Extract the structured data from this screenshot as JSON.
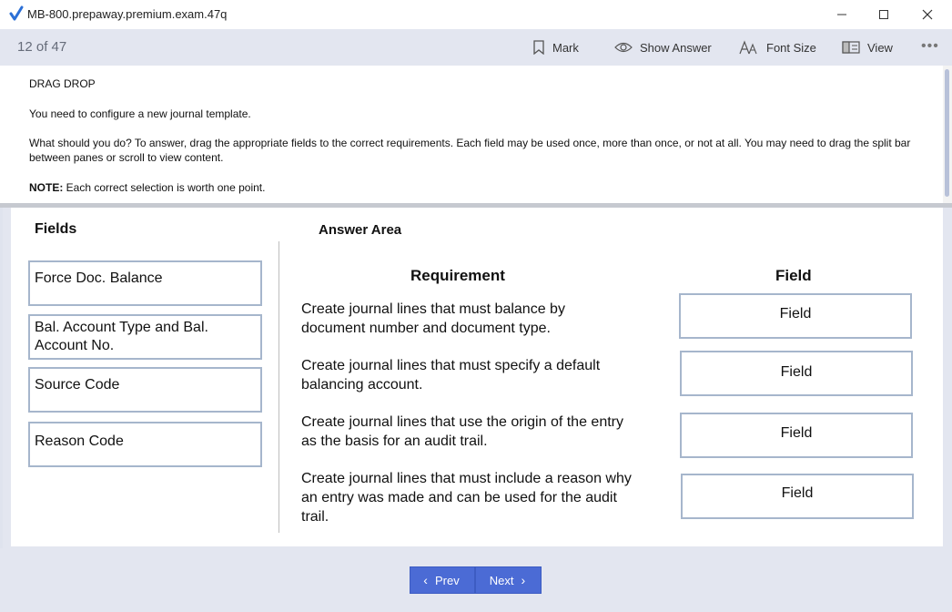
{
  "window": {
    "title": "MB-800.prepaway.premium.exam.47q"
  },
  "toolbar": {
    "counter": "12 of 47",
    "mark_label": "Mark",
    "show_answer_label": "Show Answer",
    "font_size_label": "Font Size",
    "view_label": "View",
    "more_label": "•••"
  },
  "question": {
    "type": "DRAG DROP",
    "intro": "You need to configure a new journal template.",
    "instructions": "What should you do? To answer, drag the appropriate fields to the correct requirements. Each field may be used once, more than once, or not at all. You may need to drag the split bar between panes or scroll to view content.",
    "note_label": "NOTE:",
    "note_text": " Each correct selection is worth one point."
  },
  "exhibit": {
    "fields_heading": "Fields",
    "answer_area_heading": "Answer Area",
    "requirement_heading": "Requirement",
    "field_heading": "Field",
    "fields": [
      "Force Doc. Balance",
      "Bal. Account Type and Bal. Account No.",
      "Source Code",
      "Reason Code"
    ],
    "requirements": [
      "Create journal lines that must balance by document number and document type.",
      "Create journal lines that must specify a default balancing account.",
      "Create journal lines that use the origin of the entry as the basis for an audit trail.",
      "Create journal lines that must include a reason why an entry was made and can be used for the audit trail."
    ],
    "targets": [
      "Field",
      "Field",
      "Field",
      "Field"
    ]
  },
  "footer": {
    "prev_label": "Prev",
    "next_label": "Next"
  },
  "colors": {
    "toolbar_bg": "#e3e6f0",
    "nav_button": "#4b6bd5",
    "box_border": "#a6b6cc"
  }
}
